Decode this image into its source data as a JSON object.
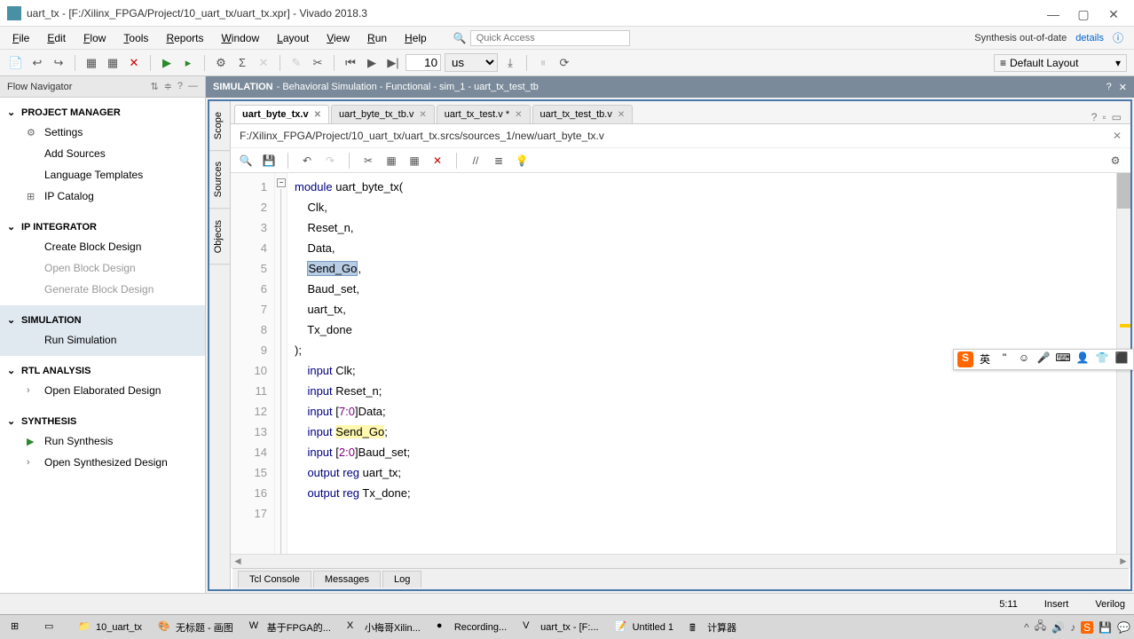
{
  "title": "uart_tx - [F:/Xilinx_FPGA/Project/10_uart_tx/uart_tx.xpr] - Vivado 2018.3",
  "menu": [
    "File",
    "Edit",
    "Flow",
    "Tools",
    "Reports",
    "Window",
    "Layout",
    "View",
    "Run",
    "Help"
  ],
  "quick_access_placeholder": "Quick Access",
  "synth_status": "Synthesis out-of-date",
  "details_label": "details",
  "toolbar": {
    "time_value": "10",
    "time_unit": "us",
    "layout": "Default Layout"
  },
  "flow_nav": {
    "title": "Flow Navigator",
    "sections": [
      {
        "name": "PROJECT MANAGER",
        "items": [
          {
            "icon": "⚙",
            "label": "Settings"
          },
          {
            "icon": "",
            "label": "Add Sources"
          },
          {
            "icon": "",
            "label": "Language Templates"
          },
          {
            "icon": "⊞",
            "label": "IP Catalog"
          }
        ]
      },
      {
        "name": "IP INTEGRATOR",
        "items": [
          {
            "icon": "",
            "label": "Create Block Design"
          },
          {
            "icon": "",
            "label": "Open Block Design",
            "disabled": true
          },
          {
            "icon": "",
            "label": "Generate Block Design",
            "disabled": true
          }
        ]
      },
      {
        "name": "SIMULATION",
        "active": true,
        "items": [
          {
            "icon": "",
            "label": "Run Simulation"
          }
        ]
      },
      {
        "name": "RTL ANALYSIS",
        "items": [
          {
            "icon": "›",
            "label": "Open Elaborated Design"
          }
        ]
      },
      {
        "name": "SYNTHESIS",
        "items": [
          {
            "icon": "▶",
            "label": "Run Synthesis",
            "icon_color": "#2a8a2a"
          },
          {
            "icon": "›",
            "label": "Open Synthesized Design"
          }
        ]
      }
    ]
  },
  "sim_header": {
    "title": "SIMULATION",
    "subtitle": "- Behavioral Simulation - Functional - sim_1 - uart_tx_test_tb"
  },
  "vert_tabs": [
    "Scope",
    "Sources",
    "Objects"
  ],
  "file_tabs": [
    {
      "name": "uart_byte_tx.v",
      "active": true
    },
    {
      "name": "uart_byte_tx_tb.v"
    },
    {
      "name": "uart_tx_test.v *"
    },
    {
      "name": "uart_tx_test_tb.v"
    }
  ],
  "file_path": "F:/Xilinx_FPGA/Project/10_uart_tx/uart_tx.srcs/sources_1/new/uart_byte_tx.v",
  "code": [
    {
      "n": 1,
      "html": "<span class='kw'>module</span> uart_byte_tx("
    },
    {
      "n": 2,
      "html": "    Clk,"
    },
    {
      "n": 3,
      "html": "    Reset_n,"
    },
    {
      "n": 4,
      "html": "    Data,"
    },
    {
      "n": 5,
      "html": "    <span class='sel'>Send_Go</span>,"
    },
    {
      "n": 6,
      "html": "    Baud_set,"
    },
    {
      "n": 7,
      "html": "    uart_tx,"
    },
    {
      "n": 8,
      "html": "    Tx_done"
    },
    {
      "n": 9,
      "html": ");"
    },
    {
      "n": 10,
      "html": "    <span class='kw'>input</span> Clk;"
    },
    {
      "n": 11,
      "html": "    <span class='kw'>input</span> Reset_n;"
    },
    {
      "n": 12,
      "html": "    <span class='kw'>input</span> [<span class='range'>7:0</span>]Data;"
    },
    {
      "n": 13,
      "html": "    <span class='kw'>input</span> <span class='hl'>Send_Go</span>;"
    },
    {
      "n": 14,
      "html": "    <span class='kw'>input</span> [<span class='range'>2:0</span>]Baud_set;"
    },
    {
      "n": 15,
      "html": "    <span class='kw'>output</span> <span class='kw'>reg</span> uart_tx;"
    },
    {
      "n": 16,
      "html": "    <span class='kw'>output</span> <span class='kw'>reg</span> Tx_done;"
    },
    {
      "n": 17,
      "html": ""
    }
  ],
  "bottom_tabs": [
    "Tcl Console",
    "Messages",
    "Log"
  ],
  "status": {
    "pos": "5:11",
    "mode": "Insert",
    "lang": "Verilog"
  },
  "ime": {
    "s": "S",
    "lang": "英",
    "items": [
      "☺",
      "🎤",
      "⌨",
      "👤",
      "👕",
      "⬛"
    ]
  },
  "taskbar": [
    {
      "icon": "⊞",
      "label": ""
    },
    {
      "icon": "▭",
      "label": ""
    },
    {
      "icon": "📁",
      "label": "10_uart_tx"
    },
    {
      "icon": "🎨",
      "label": "无标题 - 画图"
    },
    {
      "icon": "W",
      "label": "基于FPGA的..."
    },
    {
      "icon": "X",
      "label": "小梅哥Xilin..."
    },
    {
      "icon": "●",
      "label": "Recording..."
    },
    {
      "icon": "V",
      "label": "uart_tx - [F:..."
    },
    {
      "icon": "📝",
      "label": "Untitled 1"
    },
    {
      "icon": "🖩",
      "label": "计算器"
    }
  ]
}
